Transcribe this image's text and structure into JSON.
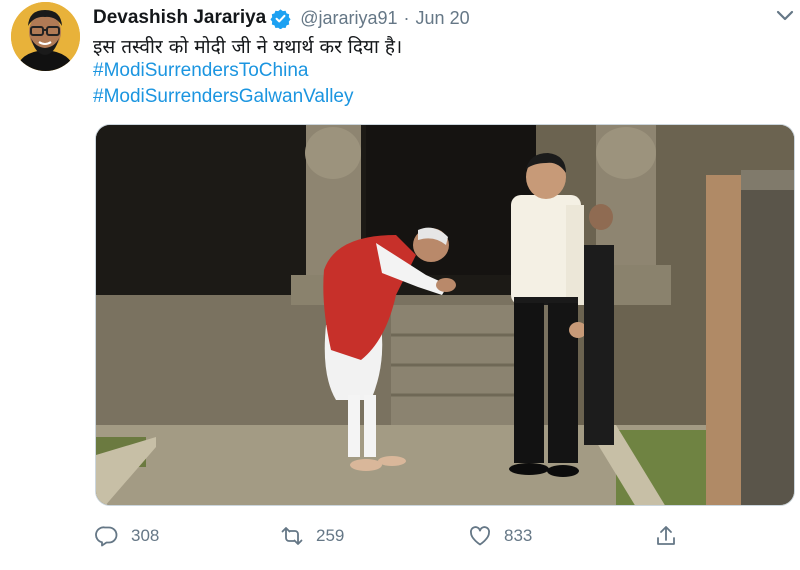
{
  "tweet": {
    "author_name": "Devashish Jarariya",
    "handle": "@jarariya91",
    "separator": "·",
    "date": "Jun 20",
    "text": "इस तस्वीर को मोदी जी ने यथार्थ कर दिया है।",
    "hashtags": [
      "#ModiSurrendersToChina",
      "#ModiSurrendersGalwanValley"
    ],
    "verified": true
  },
  "actions": {
    "replies": "308",
    "retweets": "259",
    "likes": "833"
  },
  "icons": {
    "verified": "verified-badge-icon",
    "caret": "chevron-down-icon",
    "reply": "reply-icon",
    "retweet": "retweet-icon",
    "like": "heart-icon",
    "share": "share-icon"
  },
  "colors": {
    "link": "#1b95e0",
    "verified": "#1da1f2",
    "secondary_text": "#657786"
  }
}
